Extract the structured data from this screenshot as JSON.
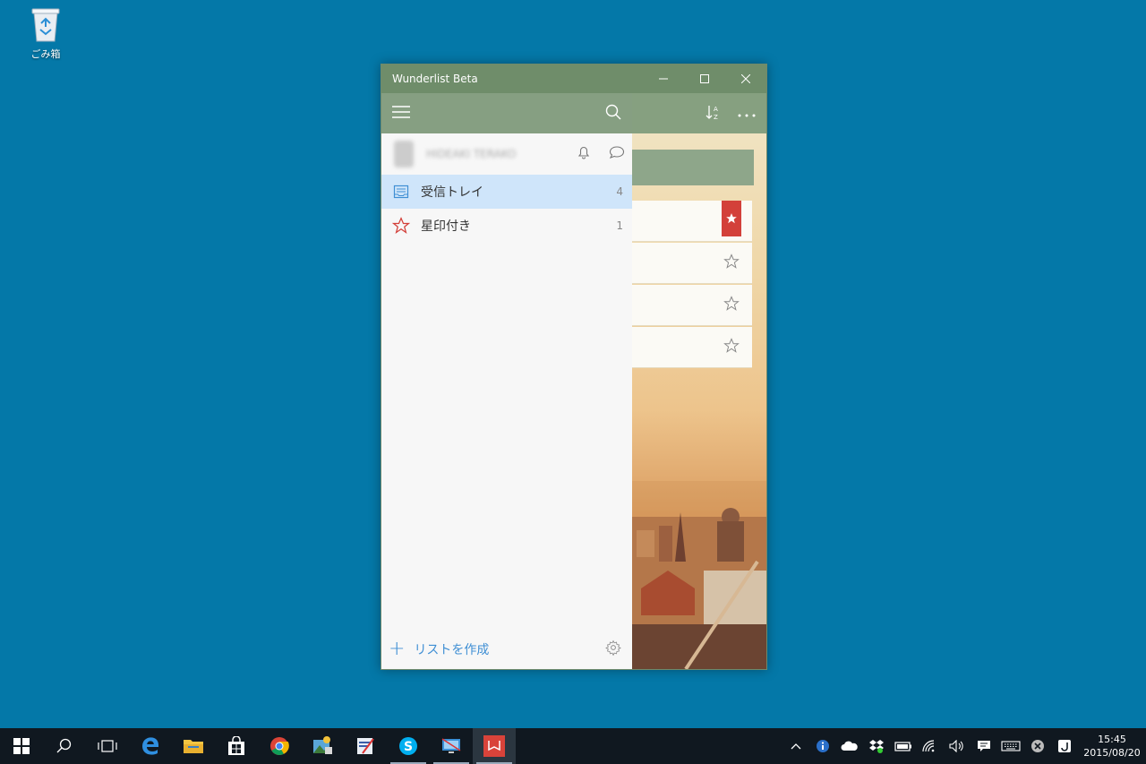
{
  "desktop": {
    "recycle_bin_label": "ごみ箱"
  },
  "window": {
    "title": "Wunderlist Beta"
  },
  "sidebar": {
    "user_name": "HIDEAKI TERAKO",
    "lists": [
      {
        "label": "受信トレイ",
        "count": "4",
        "icon": "inbox-icon",
        "active": true
      },
      {
        "label": "星印付き",
        "count": "1",
        "icon": "star-icon",
        "active": false
      }
    ],
    "create_list_label": "リストを作成"
  },
  "content": {
    "tasks": [
      {
        "starred": true
      },
      {
        "starred": false
      },
      {
        "starred": false
      },
      {
        "starred": false
      }
    ]
  },
  "taskbar": {
    "apps": [
      "start",
      "search",
      "task-view",
      "edge",
      "file-explorer",
      "store",
      "chrome",
      "photos",
      "paint",
      "skype",
      "remote-desktop",
      "wunderlist"
    ],
    "clock_time": "15:45",
    "clock_date": "2015/08/20"
  },
  "colors": {
    "desktop": "#0478a8",
    "titlebar": "#6f8d6a",
    "header": "#869f82",
    "active_list": "#cfe5fa",
    "accent_blue": "#3f8fd4",
    "star_red": "#d3403a"
  }
}
